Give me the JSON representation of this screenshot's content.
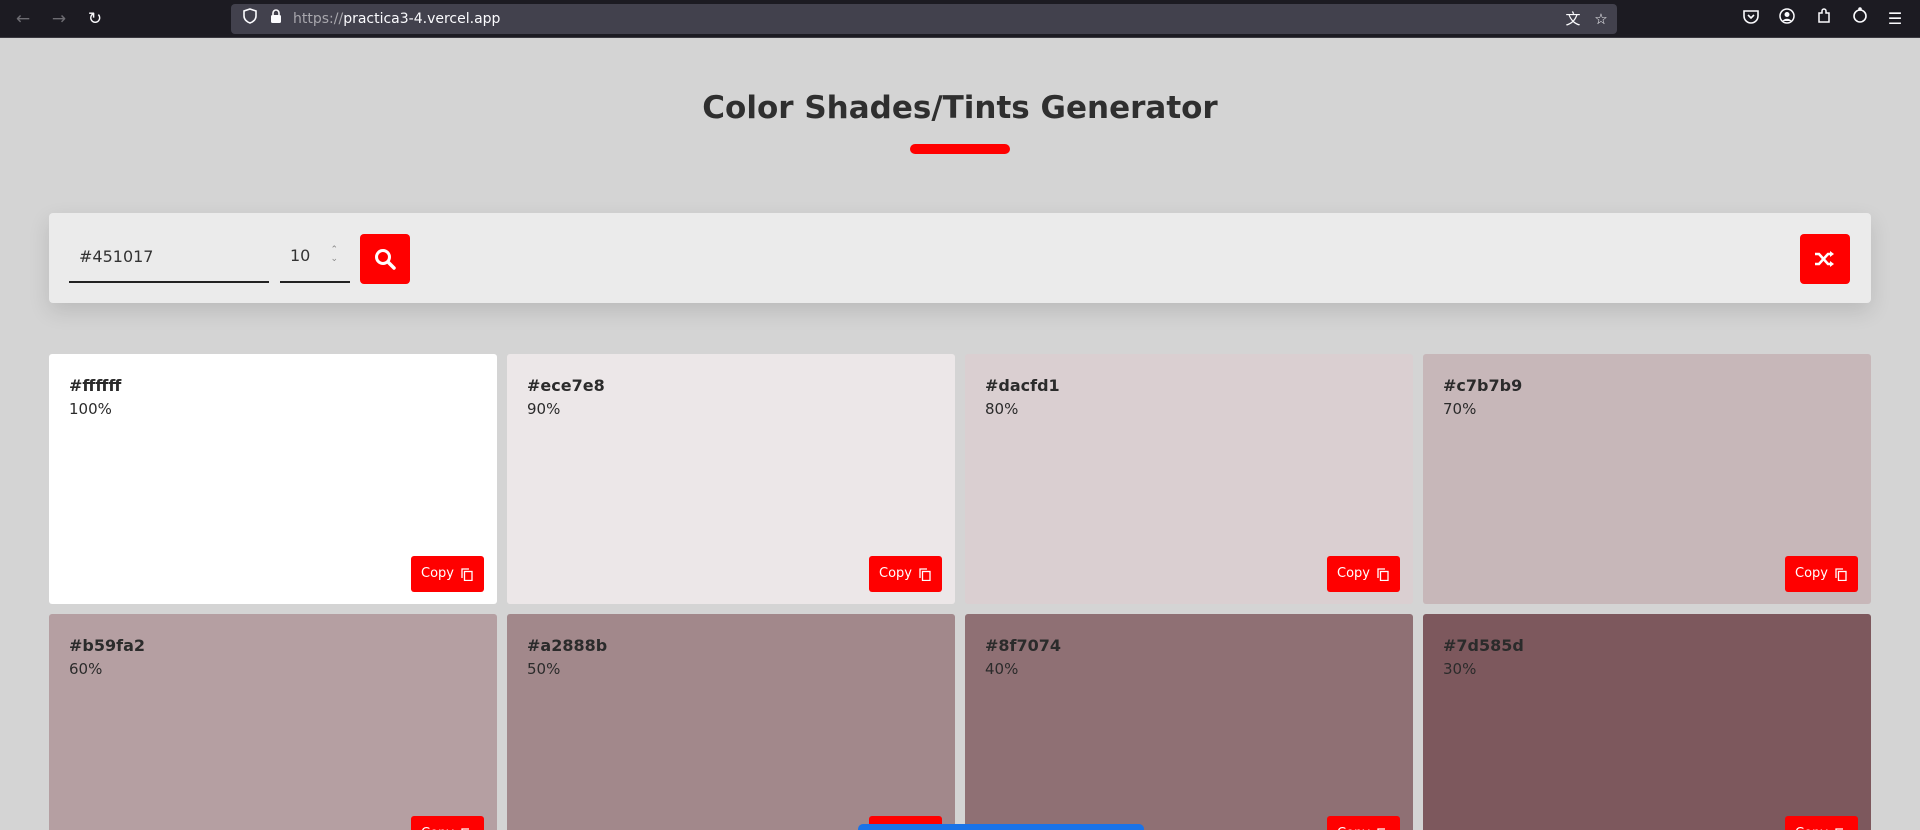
{
  "browser": {
    "url_scheme": "https://",
    "url_host": "practica3-4.vercel.app",
    "back_icon": "arrow-left-icon",
    "forward_icon": "arrow-right-icon",
    "reload_icon": "reload-icon"
  },
  "page": {
    "title": "Color Shades/Tints Generator",
    "accent_color": "#ff0000"
  },
  "controls": {
    "hex_value": "#451017",
    "count_value": "10",
    "search_icon": "search-icon",
    "random_icon": "shuffle-icon"
  },
  "palette": {
    "copy_label": "Copy",
    "cards": [
      {
        "hex": "#ffffff",
        "percent": "100%",
        "color": "#ffffff"
      },
      {
        "hex": "#ece7e8",
        "percent": "90%",
        "color": "#ece7e8"
      },
      {
        "hex": "#dacfd1",
        "percent": "80%",
        "color": "#dacfd1"
      },
      {
        "hex": "#c7b7b9",
        "percent": "70%",
        "color": "#c7b7b9"
      },
      {
        "hex": "#b59fa2",
        "percent": "60%",
        "color": "#b59fa2"
      },
      {
        "hex": "#a2888b",
        "percent": "50%",
        "color": "#a2888b"
      },
      {
        "hex": "#8f7074",
        "percent": "40%",
        "color": "#8f7074"
      },
      {
        "hex": "#7d585d",
        "percent": "30%",
        "color": "#7d585d"
      }
    ]
  }
}
